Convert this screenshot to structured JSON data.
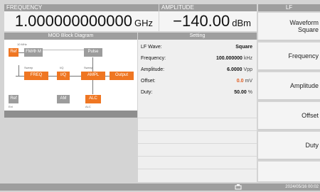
{
  "frequency": {
    "label": "FREQUENCY",
    "value": "1.000000000000",
    "unit": "GHz"
  },
  "amplitude": {
    "label": "AMPLITUDE",
    "value": "−140.00",
    "unit": "dBm"
  },
  "mod_panel": {
    "title": "MOD Block Diagram",
    "blocks": {
      "ref1": "Ref",
      "fmpm": "FM/Φ M",
      "pulse": "Pulse",
      "freq": "FREQ",
      "iq": "I/Q",
      "ampl": "AMPL",
      "output": "Output",
      "ref2": "Ref",
      "am": "AM",
      "alc": "ALC"
    },
    "tiny_labels": {
      "t1": "10 MHz",
      "t2": "Sweep",
      "t3": "I/Q",
      "t4": "Sweep",
      "t5": "ALC",
      "t6": "Ext"
    }
  },
  "settings_panel": {
    "title": "Setting",
    "rows": [
      {
        "label": "LF Wave:",
        "value": "Square",
        "unit": ""
      },
      {
        "label": "Frequency:",
        "value": "100.000000",
        "unit": "kHz"
      },
      {
        "label": "Amplitude:",
        "value": "6.0000",
        "unit": "Vpp"
      },
      {
        "label": "Offset:",
        "value": "0.0",
        "unit": "mV"
      },
      {
        "label": "Duty:",
        "value": "50.00",
        "unit": "%"
      }
    ]
  },
  "softkeys": {
    "header": "LF",
    "waveform_line1": "Waveform",
    "waveform_line2": "Square",
    "frequency": "Frequency",
    "amplitude": "Amplitude",
    "offset": "Offset",
    "duty": "Duty"
  },
  "status": {
    "datetime": "2024/05/16 00:02"
  },
  "colors": {
    "accent_orange": "#ef7622",
    "offset_value": "#e05a1e"
  }
}
